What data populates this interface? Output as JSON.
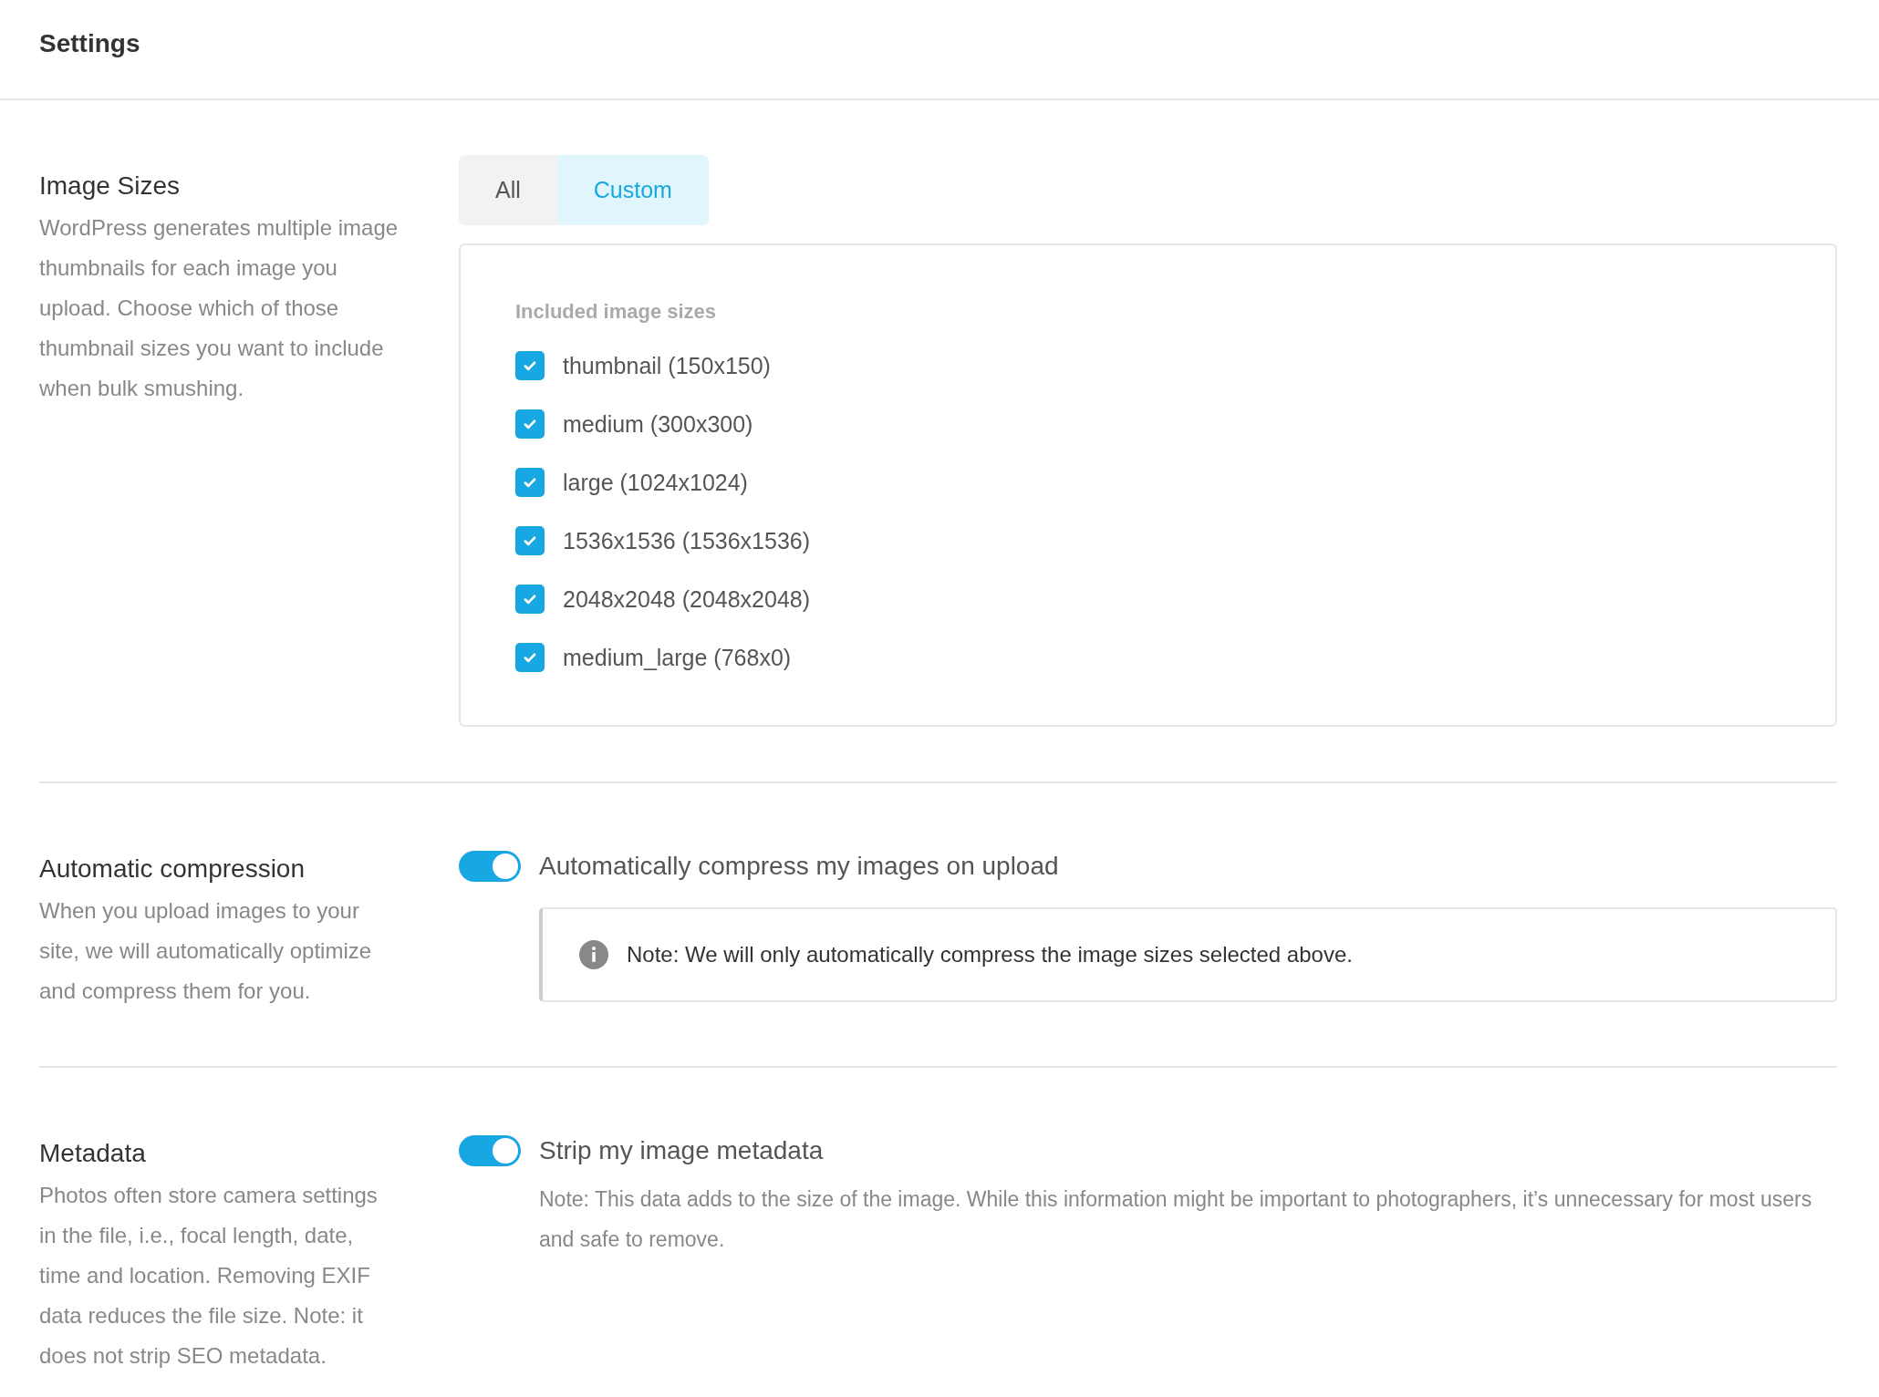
{
  "header": {
    "title": "Settings"
  },
  "sections": [
    {
      "kind": "image_sizes",
      "title": "Image Sizes",
      "description": "WordPress generates multiple image thumbnails for each image you upload. Choose which of those thumbnail sizes you want to include when bulk smushing.",
      "tabs": [
        {
          "label": "All",
          "selected": false
        },
        {
          "label": "Custom",
          "selected": true
        }
      ],
      "panel": {
        "label": "Included image sizes",
        "sizes": [
          {
            "label": "thumbnail (150x150)",
            "checked": true
          },
          {
            "label": "medium (300x300)",
            "checked": true
          },
          {
            "label": "large (1024x1024)",
            "checked": true
          },
          {
            "label": "1536x1536 (1536x1536)",
            "checked": true
          },
          {
            "label": "2048x2048 (2048x2048)",
            "checked": true
          },
          {
            "label": "medium_large (768x0)",
            "checked": true
          }
        ]
      }
    },
    {
      "kind": "toggle_note",
      "title": "Automatic compression",
      "description": "When you upload images to your site, we will automatically optimize and compress them for you.",
      "toggle": {
        "label": "Automatically compress my images on upload",
        "on": true
      },
      "note": "Note: We will only automatically compress the image sizes selected above."
    },
    {
      "kind": "toggle_text",
      "title": "Metadata",
      "description": "Photos often store camera settings in the file, i.e., focal length, date, time and location. Removing EXIF data reduces the file size. Note: it does not strip SEO metadata.",
      "toggle": {
        "label": "Strip my image metadata",
        "on": true
      },
      "note": "Note: This data adds to the size of the image. While this information might be important to photographers, it’s unnecessary for most users and safe to remove."
    }
  ]
}
